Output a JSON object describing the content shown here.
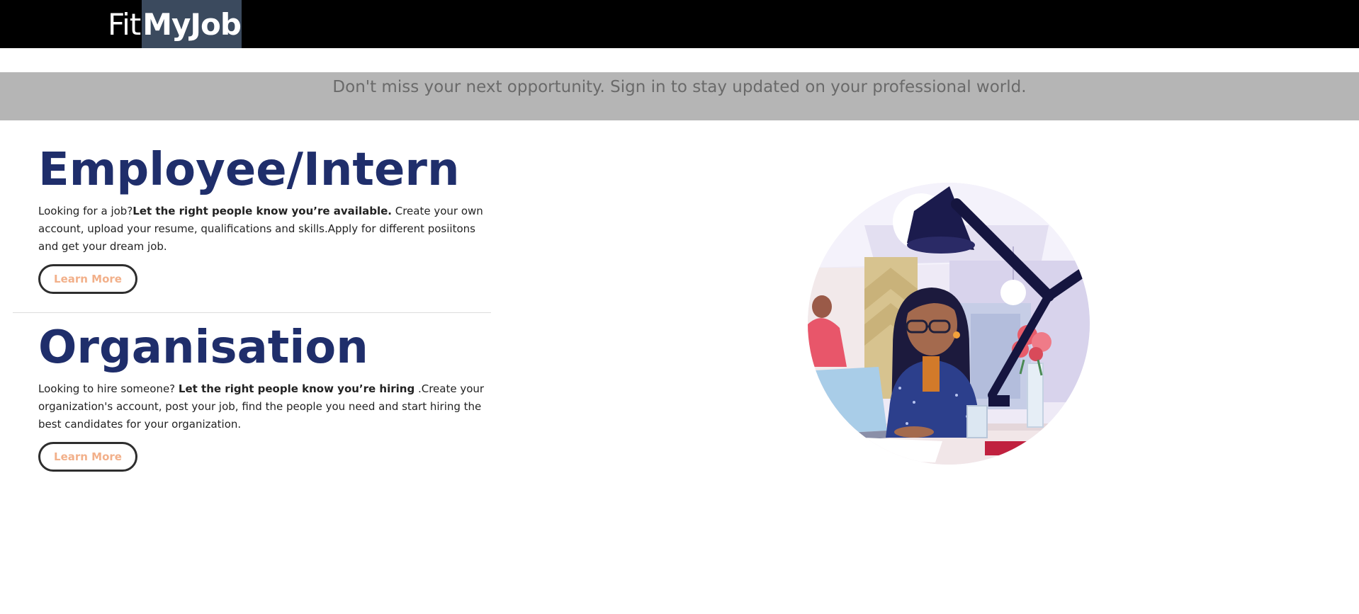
{
  "header": {
    "logo_part1": "Fit",
    "logo_part2": "MyJob"
  },
  "banner": {
    "text": "Don't miss your next opportunity. Sign in to stay updated on your professional world."
  },
  "employee": {
    "title": "Employee/Intern",
    "text_before": "Looking for a job?",
    "text_bold": "Let the right people know you’re available.",
    "text_after": " Create your own account, upload your resume, qualifications and skills.Apply for different posiitons and get your dream job.",
    "button": "Learn More"
  },
  "organisation": {
    "title": "Organisation",
    "text_before": "Looking to hire someone? ",
    "text_bold": "Let the right people know you’re hiring",
    "text_after": " .Create your organization's account, post your job, find the people you need and start hiring the best candidates for your organization.",
    "button": "Learn More"
  },
  "illustration": {
    "icon": "woman-working-at-desk-illustration"
  },
  "colors": {
    "topbar": "#000000",
    "logo_highlight": "#3b4a5e",
    "banner": "#b5b5b5",
    "heading": "#1f2e6b",
    "button_text": "#f2b08a"
  }
}
